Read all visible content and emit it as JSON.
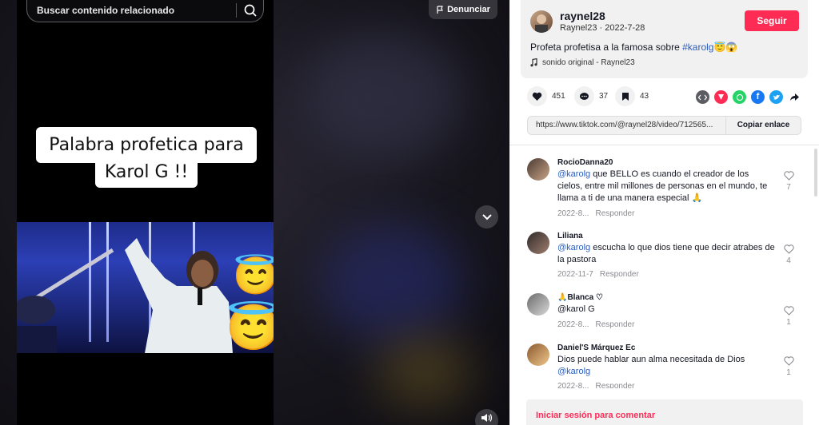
{
  "search": {
    "placeholder": "Buscar contenido relacionado"
  },
  "report_label": "Denunciar",
  "video": {
    "caption_line1": "Palabra profetica para",
    "caption_line2": "Karol G !!"
  },
  "author": {
    "username": "raynel28",
    "meta": "Raynel23 · 2022-7-28",
    "follow_label": "Seguir",
    "description_text": "Profeta profetisa a la famosa sobre ",
    "description_tag": "#karolg",
    "description_emoji": "😇😱",
    "sound": "sonido original - Raynel23"
  },
  "stats": {
    "likes": "451",
    "comments": "37",
    "saves": "43"
  },
  "share_icons": [
    "embed-icon",
    "tiktok-share-icon",
    "whatsapp-icon",
    "facebook-icon",
    "twitter-icon",
    "share-arrow-icon"
  ],
  "link": {
    "url": "https://www.tiktok.com/@raynel28/video/712565...",
    "copy_label": "Copiar enlace"
  },
  "comments": [
    {
      "user": "RocioDanna20",
      "mention": "@karolg",
      "text": " que BELLO es cuando el creador de los cielos, entre mil millones de personas en el mundo, te llama a ti de una manera especial 🙏",
      "date": "2022-8...",
      "reply": "Responder",
      "likes": "7"
    },
    {
      "user": "Liliana",
      "mention": "@karolg",
      "text": " escucha lo que dios tiene que decir atrabes de la pastora",
      "date": "2022-11-7",
      "reply": "Responder",
      "likes": "4"
    },
    {
      "user": "🙏Blanca ♡",
      "mention": "",
      "text": "@karol G",
      "date": "2022-8...",
      "reply": "Responder",
      "likes": "1"
    },
    {
      "user": "Daniel'S Márquez Ec",
      "mention": "",
      "text": "Dios puede hablar aun alma necesitada de Dios ",
      "text_mention": "@karolg",
      "date": "2022-8...",
      "reply": "Responder",
      "likes": "1"
    }
  ],
  "login_prompt": "Iniciar sesión para comentar",
  "colors": {
    "accent": "#fe2c55",
    "link": "#2b5db9"
  }
}
